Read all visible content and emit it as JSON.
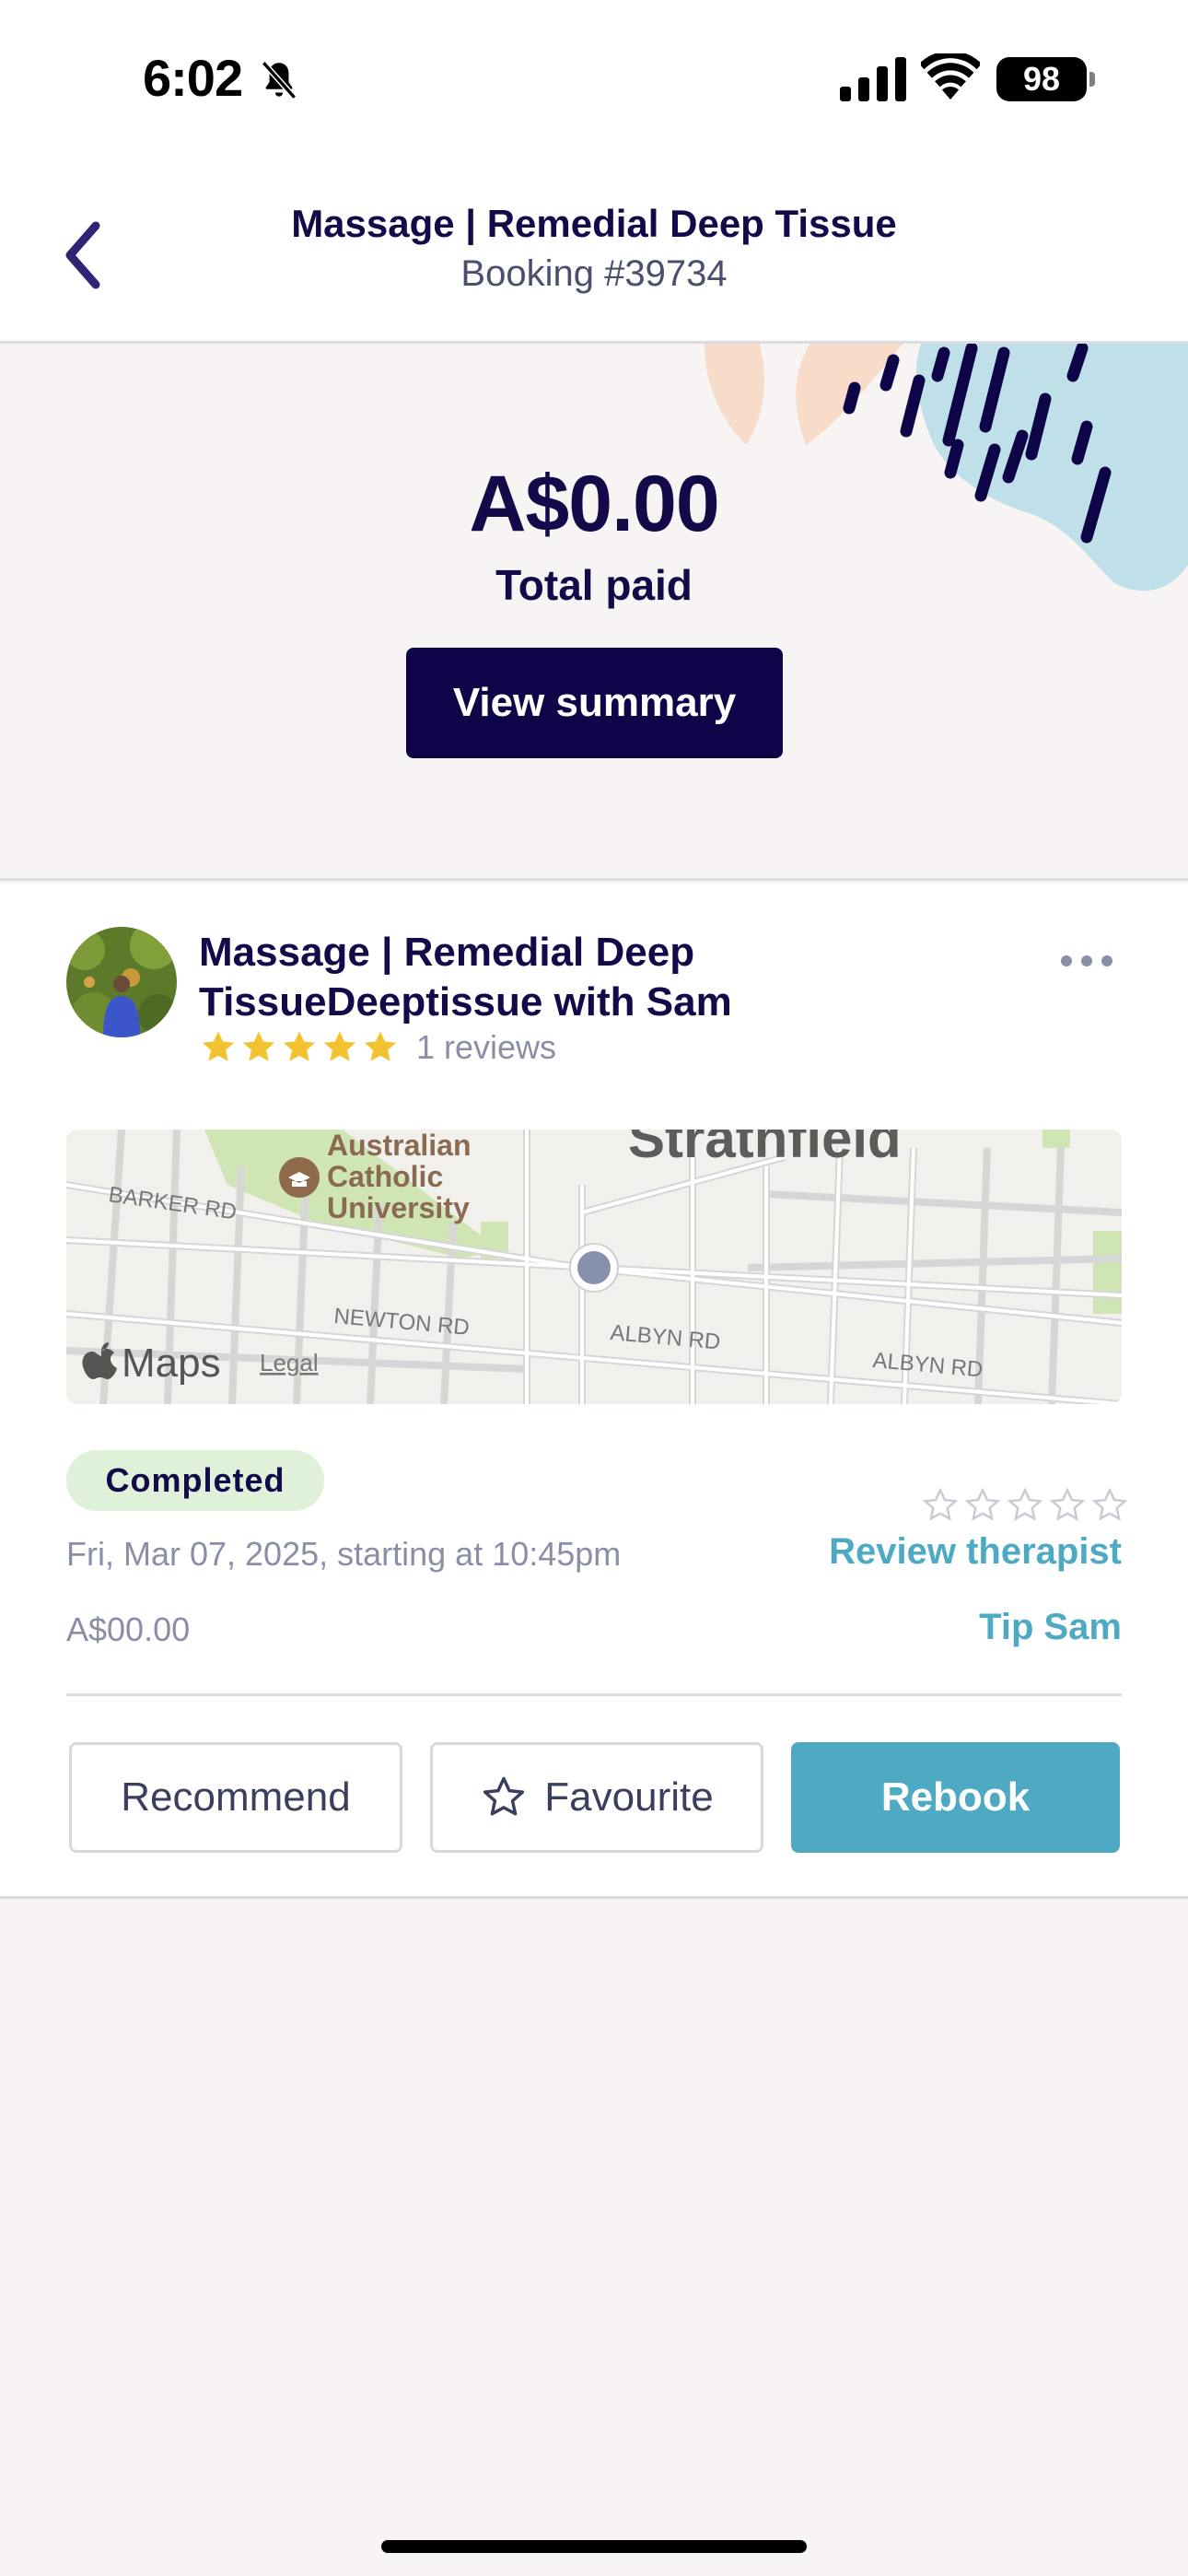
{
  "status_bar": {
    "time": "6:02",
    "battery": "98"
  },
  "header": {
    "title": "Massage | Remedial Deep Tissue",
    "subtitle": "Booking #39734"
  },
  "summary": {
    "amount": "A$0.00",
    "amount_label": "Total paid",
    "view_summary_label": "View summary"
  },
  "booking": {
    "title": "Massage  |  Remedial Deep TissueDeeptissue with Sam",
    "rating": 5,
    "reviews_text": "1 reviews",
    "status": "Completed",
    "date_text": "Fri, Mar 07, 2025, starting at 10:45pm",
    "price_text": "A$00.00",
    "review_link": "Review therapist",
    "tip_link": "Tip Sam"
  },
  "map": {
    "labels": {
      "suburb": "Strathfield",
      "poi_line1": "Australian",
      "poi_line2": "Catholic",
      "poi_line3": "University",
      "barker": "BARKER RD",
      "newton": "NEWTON RD",
      "albyn1": "ALBYN RD",
      "albyn2": "ALBYN RD",
      "maps_brand": "Maps",
      "legal": "Legal"
    }
  },
  "actions": {
    "recommend": "Recommend",
    "favourite": "Favourite",
    "rebook": "Rebook"
  },
  "colors": {
    "navy": "#130a4a",
    "teal": "#4eaac3",
    "pill_bg": "#dff1d9",
    "star": "#f2c230"
  }
}
